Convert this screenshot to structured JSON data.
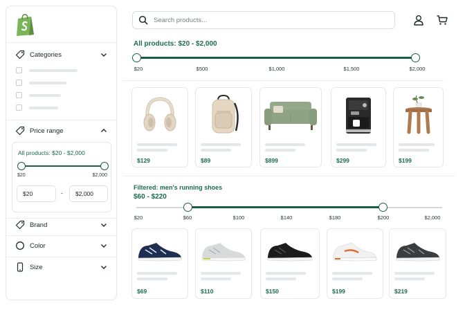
{
  "search": {
    "placeholder": "Search products..."
  },
  "sidebar": {
    "categories_label": "Categories",
    "price_range_label": "Price range",
    "brand_label": "Brand",
    "color_label": "Color",
    "size_label": "Size",
    "price_card": {
      "title": "All products: $20 - $2,000",
      "min_label": "$20",
      "max_label": "$2,000",
      "min_value": "$20",
      "max_value": "$2,000",
      "dash": "-"
    }
  },
  "all_products": {
    "title": "All products: $20 - $2,000",
    "ticks": [
      "$20",
      "$500",
      "$1,000",
      "$1,500",
      "$2,000"
    ],
    "range": [
      20,
      2000
    ],
    "products": [
      {
        "name": "headphones",
        "price": "$129"
      },
      {
        "name": "backpack",
        "price": "$89"
      },
      {
        "name": "sofa",
        "price": "$899"
      },
      {
        "name": "espresso machine",
        "price": "$299"
      },
      {
        "name": "side table",
        "price": "$199"
      }
    ]
  },
  "filtered": {
    "title": "Filtered: men's running shoes",
    "subtitle": "$60 - $220",
    "ticks": [
      "$20",
      "$60",
      "$100",
      "$140",
      "$180",
      "$200",
      "$2,000"
    ],
    "range": [
      60,
      220
    ],
    "products": [
      {
        "name": "navy running shoe",
        "price": "$69"
      },
      {
        "name": "grey running shoe",
        "price": "$110"
      },
      {
        "name": "black running shoe",
        "price": "$150"
      },
      {
        "name": "white orange running shoe",
        "price": "$199"
      },
      {
        "name": "dark grey running shoe",
        "price": "$219"
      }
    ]
  },
  "colors": {
    "accent": "#1c5b47",
    "accent_text": "#1c6b4f",
    "logo": "#7ab55c"
  }
}
